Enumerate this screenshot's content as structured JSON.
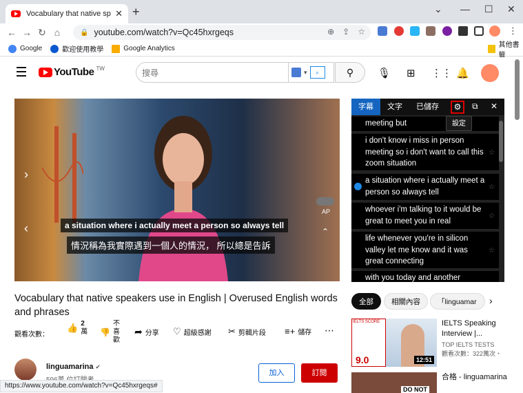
{
  "browser": {
    "tab_title": "Vocabulary that native speakers use",
    "new_tab": "+",
    "url": "youtube.com/watch?v=Qc45hxrgeqs",
    "bookmarks": [
      {
        "label": "Google",
        "color": "#4285f4"
      },
      {
        "label": "歡迎使用教學",
        "color": "#0b57d0"
      },
      {
        "label": "Google Analytics",
        "color": "#f9ab00"
      }
    ],
    "other_bookmarks": "其他書籤"
  },
  "youtube": {
    "logo_text": "YouTube",
    "region": "TW",
    "search_placeholder": "搜尋"
  },
  "player": {
    "subtitle_en": "a situation where i actually meet a person so always tell",
    "subtitle_zh": "情況稱為我實際遇到一個人的情況， 所以總是告訴",
    "ap_label": "AP"
  },
  "panel": {
    "tabs": [
      "字幕",
      "文字",
      "已儲存"
    ],
    "tooltip": "設定",
    "lines": [
      "meeting but",
      "i don't know i miss in person meeting so i don't want to call this zoom situation",
      "a situation where i actually meet a person so always tell",
      "whoever i'm talking to it would be great to meet you in real",
      "life whenever you're in silicon valley let me know and it was great connecting",
      "with you today and another"
    ]
  },
  "video": {
    "title": "Vocabulary that native speakers use in English | Overused English words and phrases",
    "views_label": "觀看次數：",
    "like_count": "2",
    "like_unit": "萬",
    "dislike_label": "不喜歡",
    "share_label": "分享",
    "thanks_label": "超級感謝",
    "clip_label": "剪輯片段",
    "save_label": "儲存",
    "more_label": "⋯"
  },
  "channel": {
    "name": "linguamarina",
    "subs": "596萬 位訂閱者",
    "join": "加入",
    "subscribe": "訂閱"
  },
  "chips": [
    "全部",
    "相關內容",
    "「linguamar"
  ],
  "related": [
    {
      "title": "IELTS Speaking Interview |...",
      "channel": "TOP IELTS TESTS",
      "meta": "觀看次數：322萬次・",
      "duration": "12:51",
      "thumb_label": "IELTS SCORE",
      "band": "9.0"
    },
    {
      "title": "合格 - linguamarina",
      "channel": "",
      "meta": "",
      "duration": "",
      "thumb_label": "DO NOT",
      "band": ""
    }
  ],
  "status_url": "https://www.youtube.com/watch?v=Qc45hxrgeqs#",
  "colors": {
    "accent": "#ff0000",
    "panel_tab": "#1565c0",
    "subscribe": "#cc0000",
    "join": "#065fd4"
  }
}
